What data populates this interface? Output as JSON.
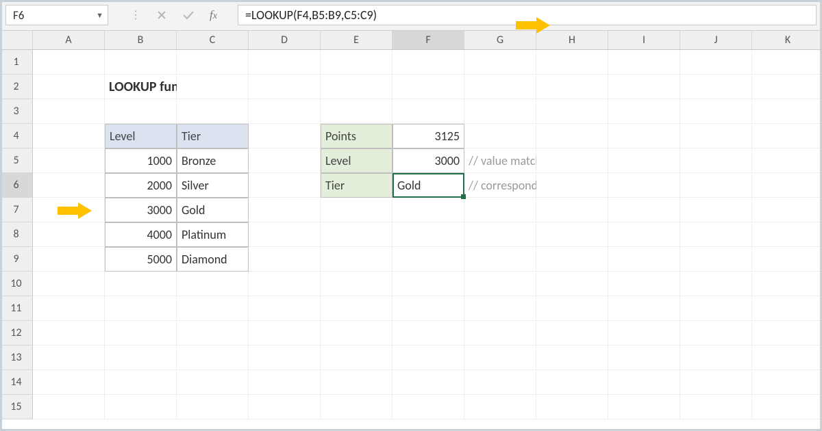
{
  "activeCellRef": "F6",
  "formula": "=LOOKUP(F4,B5:B9,C5:C9)",
  "columns": [
    "A",
    "B",
    "C",
    "D",
    "E",
    "F",
    "G",
    "H",
    "I",
    "J",
    "K"
  ],
  "rows": [
    "1",
    "2",
    "3",
    "4",
    "5",
    "6",
    "7",
    "8",
    "9",
    "10",
    "11",
    "12",
    "13",
    "14",
    "15"
  ],
  "title": "LOOKUP function",
  "lookupTable": {
    "headers": {
      "level": "Level",
      "tier": "Tier"
    },
    "rows": [
      {
        "level": "1000",
        "tier": "Bronze"
      },
      {
        "level": "2000",
        "tier": "Silver"
      },
      {
        "level": "3000",
        "tier": "Gold"
      },
      {
        "level": "4000",
        "tier": "Platinum"
      },
      {
        "level": "5000",
        "tier": "Diamond"
      }
    ]
  },
  "resultTable": {
    "rows": [
      {
        "label": "Points",
        "value": "3125",
        "note": ""
      },
      {
        "label": "Level",
        "value": "3000",
        "note": "// value matched in level"
      },
      {
        "label": "Tier",
        "value": "Gold",
        "note": "// corresponding value in tier"
      }
    ]
  },
  "colors": {
    "accent": "#1f7246",
    "arrow": "#ffc000"
  }
}
